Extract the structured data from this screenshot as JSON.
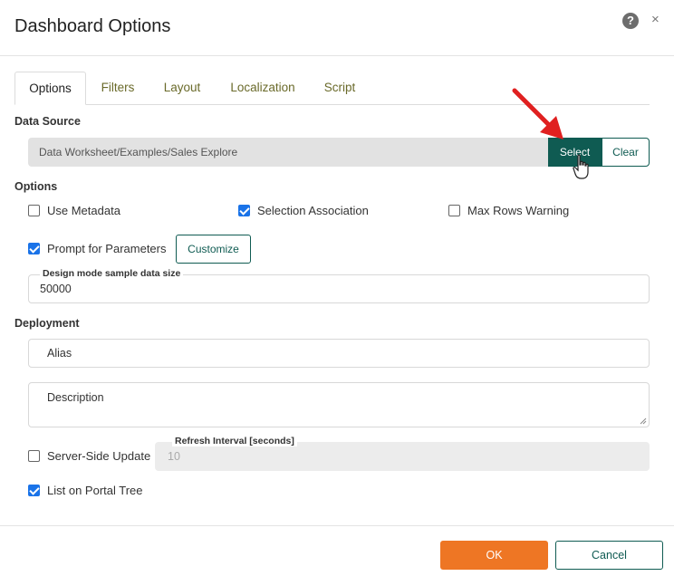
{
  "dialog": {
    "title": "Dashboard Options"
  },
  "header": {
    "help_glyph": "?",
    "close_glyph": "×"
  },
  "tabs": [
    {
      "label": "Options",
      "active": true
    },
    {
      "label": "Filters",
      "active": false
    },
    {
      "label": "Layout",
      "active": false
    },
    {
      "label": "Localization",
      "active": false
    },
    {
      "label": "Script",
      "active": false
    }
  ],
  "data_source": {
    "label": "Data Source",
    "value": "Data Worksheet/Examples/Sales Explore",
    "select_label": "Select",
    "clear_label": "Clear"
  },
  "options": {
    "label": "Options",
    "use_metadata": {
      "label": "Use Metadata",
      "checked": false
    },
    "selection_association": {
      "label": "Selection Association",
      "checked": true
    },
    "max_rows_warning": {
      "label": "Max Rows Warning",
      "checked": false
    },
    "prompt_for_parameters": {
      "label": "Prompt for Parameters",
      "checked": true
    },
    "customize_label": "Customize",
    "sample_size": {
      "label": "Design mode sample data size",
      "value": "50000"
    }
  },
  "deployment": {
    "label": "Deployment",
    "alias_placeholder": "Alias",
    "description_placeholder": "Description",
    "server_side_update": {
      "label": "Server-Side Update",
      "checked": false
    },
    "refresh_interval": {
      "label": "Refresh Interval [seconds]",
      "value": "10"
    },
    "list_on_portal_tree": {
      "label": "List on Portal Tree",
      "checked": true
    }
  },
  "footer": {
    "ok_label": "OK",
    "cancel_label": "Cancel"
  },
  "colors": {
    "primary": "#0f5b52",
    "accent": "#ee7624",
    "checkbox": "#1a73e8",
    "annotation_arrow": "#e02020"
  }
}
